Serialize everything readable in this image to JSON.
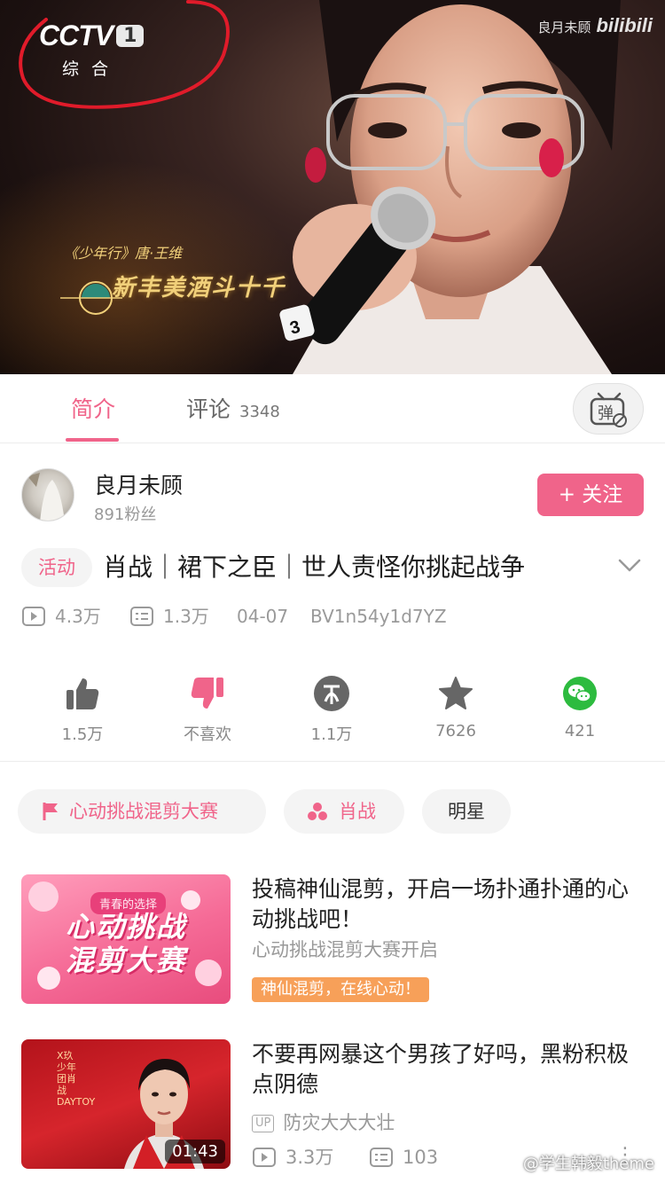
{
  "video": {
    "channel_logo": "CCTV",
    "channel_number": "1",
    "channel_sub": "综合",
    "watermark_user": "良月未顾",
    "watermark_site": "bilibili",
    "poem_source": "《少年行》唐·王维",
    "poem_line": "新丰美酒斗十千",
    "mic_number": "3"
  },
  "tabs": {
    "intro": "简介",
    "comments": "评论",
    "comments_count": "3348",
    "danmu_label": "弹"
  },
  "uploader": {
    "name": "良月未顾",
    "fans": "891粉丝",
    "follow_label": "+ 关注"
  },
  "video_info": {
    "activity_tag": "活动",
    "title": "肖战｜裙下之臣｜世人责怪你挑起战争",
    "plays": "4.3万",
    "danmaku": "1.3万",
    "date": "04-07",
    "bvid": "BV1n54y1d7YZ"
  },
  "actions": [
    {
      "icon": "thumbs-up-icon",
      "label": "1.5万"
    },
    {
      "icon": "thumbs-down-icon",
      "label": "不喜欢"
    },
    {
      "icon": "coin-icon",
      "label": "1.1万"
    },
    {
      "icon": "star-icon",
      "label": "7626"
    },
    {
      "icon": "wechat-icon",
      "label": "421"
    }
  ],
  "tags": [
    {
      "icon": "flag-icon",
      "label": "心动挑战混剪大赛"
    },
    {
      "icon": "circles-icon",
      "label": "肖战"
    },
    {
      "icon": "",
      "label": "明星"
    }
  ],
  "related": [
    {
      "thumb_top": "青春的选择",
      "thumb_main_1": "心动挑战",
      "thumb_main_2": "混剪大赛",
      "title": "投稿神仙混剪，开启一场扑通扑通的心动挑战吧！",
      "subtitle": "心动挑战混剪大赛开启",
      "badge": "神仙混剪，在线心动！"
    },
    {
      "thumb_vertical": "X玖少年团肖战DAYTOY",
      "duration": "01:43",
      "title": "不要再网暴这个男孩了好吗，黑粉积极点阴德",
      "up_badge": "UP",
      "uploader": "防灾大大大壮",
      "plays": "3.3万",
      "danmaku": "103"
    }
  ],
  "watermark_bottom": "@学生韩毅theme",
  "colors": {
    "accent": "#f0648a",
    "promo": "#f7a059",
    "wechat": "#2dbb3f",
    "muted": "#999999"
  }
}
